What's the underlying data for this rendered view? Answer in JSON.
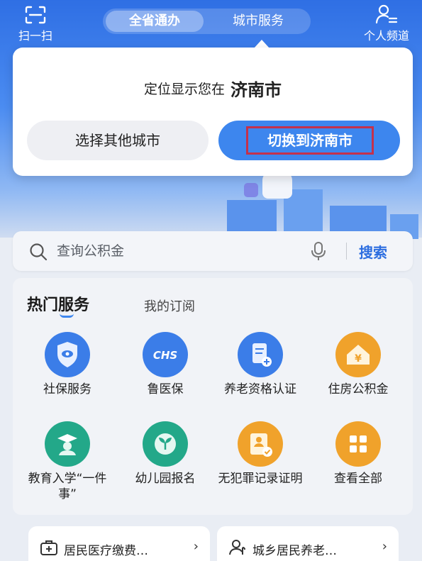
{
  "topbar": {
    "scan_label": "扫一扫",
    "tabs": [
      {
        "label": "全省通办",
        "active": true
      },
      {
        "label": "城市服务",
        "active": false
      }
    ],
    "channel_label": "个人频道"
  },
  "popup": {
    "prefix": "定位显示您在",
    "city": "济南市",
    "other_city_button": "选择其他城市",
    "switch_button": "切换到济南市"
  },
  "search": {
    "placeholder": "查询公积金",
    "button": "搜索"
  },
  "services": {
    "tab_hot": "热门服务",
    "tab_subscribed": "我的订阅",
    "items": [
      {
        "label": "社保服务",
        "icon": "shield-eye-icon",
        "color": "#3b7de8"
      },
      {
        "label": "鲁医保",
        "icon": "chs-icon",
        "color": "#3b7de8"
      },
      {
        "label": "养老资格认证",
        "icon": "document-plus-icon",
        "color": "#3b7de8"
      },
      {
        "label": "住房公积金",
        "icon": "house-yen-icon",
        "color": "#f0a22b"
      },
      {
        "label": "教育入学“一件事”",
        "icon": "graduate-icon",
        "color": "#23a889"
      },
      {
        "label": "幼儿园报名",
        "icon": "sprout-icon",
        "color": "#23a889"
      },
      {
        "label": "无犯罪记录证明",
        "icon": "id-card-check-icon",
        "color": "#f0a22b"
      },
      {
        "label": "查看全部",
        "icon": "grid-icon",
        "color": "#f0a22b"
      }
    ]
  },
  "bottom_cards": [
    {
      "label": "居民医疗缴费…",
      "icon": "medical-bag-icon"
    },
    {
      "label": "城乡居民养老…",
      "icon": "elder-person-icon"
    }
  ]
}
